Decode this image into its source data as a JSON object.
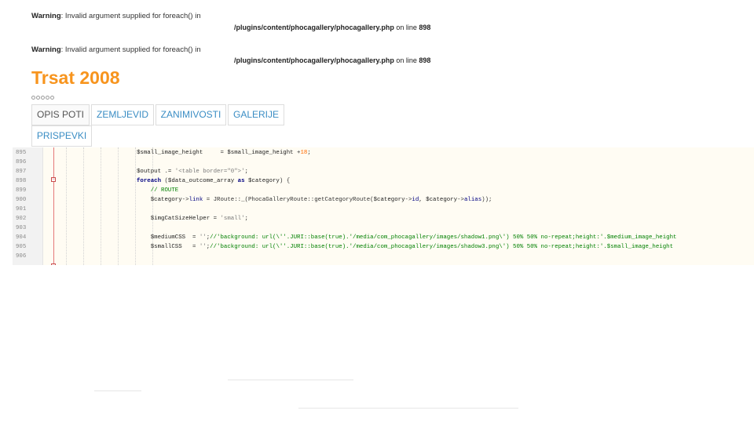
{
  "warnings": [
    {
      "label": "Warning",
      "message": ": Invalid argument supplied for foreach() in",
      "path": "/plugins/content/phocagallery/phocagallery.php",
      "on_line": " on line ",
      "line_no": "898"
    },
    {
      "label": "Warning",
      "message": ": Invalid argument supplied for foreach() in",
      "path": "/plugins/content/phocagallery/phocagallery.php",
      "on_line": " on line ",
      "line_no": "898"
    }
  ],
  "page_title": "Trsat 2008",
  "rating": {
    "filled": 0,
    "max": 5
  },
  "tabs": [
    {
      "label": "OPIS POTI",
      "active": true
    },
    {
      "label": "ZEMLJEVID",
      "active": false
    },
    {
      "label": "ZANIMIVOSTI",
      "active": false
    },
    {
      "label": "GALERIJE",
      "active": false
    },
    {
      "label": "PRISPEVKI",
      "active": false
    }
  ],
  "code_lines": [
    {
      "no": "895",
      "html": "<span class=\"v\">$small_image_height</span>     = <span class=\"v\">$small_image_height</span> +<span class=\"n\">18</span>;"
    },
    {
      "no": "896",
      "html": ""
    },
    {
      "no": "897",
      "html": "<span class=\"v\">$output</span> .= <span class=\"s\">'&lt;table border=\"0\"&gt;'</span>;"
    },
    {
      "no": "898",
      "html": "<span class=\"k\">foreach</span> (<span class=\"v\">$data_outcome_array</span> <span class=\"k\">as</span> <span class=\"v\">$category</span>) {"
    },
    {
      "no": "899",
      "html": "    <span class=\"cm\">// ROUTE</span>"
    },
    {
      "no": "900",
      "html": "    <span class=\"v\">$category</span>-&gt;<span class=\"op\">link</span> = JRoute::_(PhocaGalleryRoute::getCategoryRoute(<span class=\"v\">$category</span>-&gt;<span class=\"op\">id</span>, <span class=\"v\">$category</span>-&gt;<span class=\"op\">alias</span>));"
    },
    {
      "no": "901",
      "html": ""
    },
    {
      "no": "902",
      "html": "    <span class=\"v\">$imgCatSizeHelper</span> = <span class=\"s\">'small'</span>;"
    },
    {
      "no": "903",
      "html": ""
    },
    {
      "no": "904",
      "html": "    <span class=\"v\">$mediumCSS</span>  = <span class=\"s\">''</span>;<span class=\"cm\">//'background: url(\\''.JURI::base(true).'/media/com_phocagallery/images/shadow1.png\\') 50% 50% no-repeat;height:'.$medium_image_height</span>"
    },
    {
      "no": "905",
      "html": "    <span class=\"v\">$smallCSS</span>   = <span class=\"s\">''</span>;<span class=\"cm\">//'background: url(\\''.JURI::base(true).'/media/com_phocagallery/images/shadow3.png\\') 50% 50% no-repeat;height:'.$small_image_height</span>"
    },
    {
      "no": "906",
      "html": ""
    }
  ],
  "colors": {
    "title": "#f7941d",
    "tab_link": "#3a8dc4",
    "code_bg": "#fffcf3",
    "fold_marker": "#c94c4c",
    "comment": "#008000",
    "keyword": "#000080"
  }
}
